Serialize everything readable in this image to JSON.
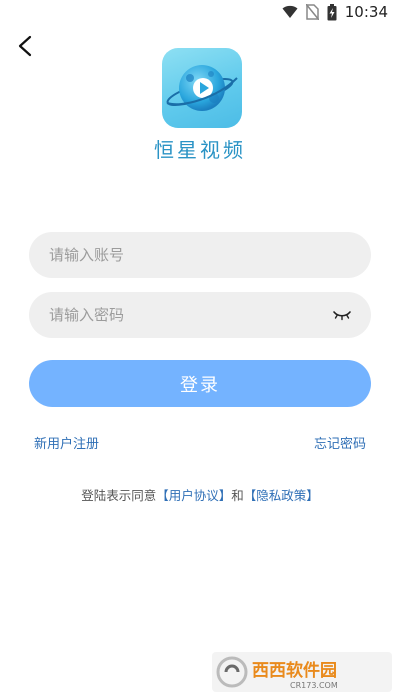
{
  "status_bar": {
    "time": "10:34",
    "icons": [
      "wifi-icon",
      "no-sim-icon",
      "battery-charging-icon"
    ]
  },
  "header": {
    "back_icon": "chevron-left-icon"
  },
  "app": {
    "name": "恒星视频",
    "logo_icon": "planet-play-icon"
  },
  "form": {
    "account_placeholder": "请输入账号",
    "password_placeholder": "请输入密码",
    "password_toggle_icon": "eye-closed-icon",
    "login_label": "登录"
  },
  "links": {
    "register": "新用户注册",
    "forgot": "忘记密码"
  },
  "agreement": {
    "prefix": "登陆表示同意",
    "user_agreement": "【用户协议】",
    "and": "和",
    "privacy_policy": "【隐私政策】"
  },
  "colors": {
    "primary": "#74b3ff",
    "link": "#2f6fb6",
    "title": "#2a93c5",
    "input_bg": "#efefef"
  },
  "watermark": {
    "text": "西西软件园",
    "subtext": "CR173.COM"
  }
}
